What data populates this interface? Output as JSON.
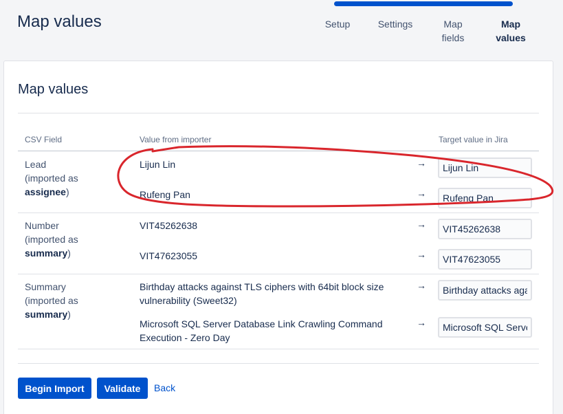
{
  "header": {
    "title": "Map values",
    "steps": [
      {
        "label": "Setup",
        "active": false
      },
      {
        "label": "Settings",
        "active": false
      },
      {
        "label": "Map\nfields",
        "active": false
      },
      {
        "label": "Map\nvalues",
        "active": true
      }
    ]
  },
  "card": {
    "title": "Map values",
    "columns": {
      "csv_field": "CSV Field",
      "value_from_importer": "Value from importer",
      "target_value": "Target value in Jira"
    },
    "rows": [
      {
        "field_name": "Lead",
        "imported_as_prefix": "(imported as",
        "imported_as": "assignee",
        "imported_as_suffix": ")",
        "values": [
          {
            "source": "Lijun Lin",
            "target": "Lijun Lin"
          },
          {
            "source": "Rufeng Pan",
            "target": "Rufeng Pan"
          }
        ]
      },
      {
        "field_name": "Number",
        "imported_as_prefix": "(imported as",
        "imported_as": "summary",
        "imported_as_suffix": ")",
        "values": [
          {
            "source": "VIT45262638",
            "target": "VIT45262638"
          },
          {
            "source": "VIT47623055",
            "target": "VIT47623055"
          }
        ]
      },
      {
        "field_name": "Summary",
        "imported_as_prefix": "(imported as",
        "imported_as": "summary",
        "imported_as_suffix": ")",
        "values": [
          {
            "source": "Birthday attacks against TLS ciphers with 64bit block size vulnerability (Sweet32)",
            "target": "Birthday attacks aga"
          },
          {
            "source": "Microsoft SQL Server Database Link Crawling Command Execution - Zero Day",
            "target": "Microsoft SQL Serve"
          }
        ]
      }
    ],
    "arrow_symbol": "→"
  },
  "actions": {
    "begin_import": "Begin Import",
    "validate": "Validate",
    "back": "Back"
  },
  "colors": {
    "primary": "#0052cc",
    "annotation": "#d9262c"
  }
}
